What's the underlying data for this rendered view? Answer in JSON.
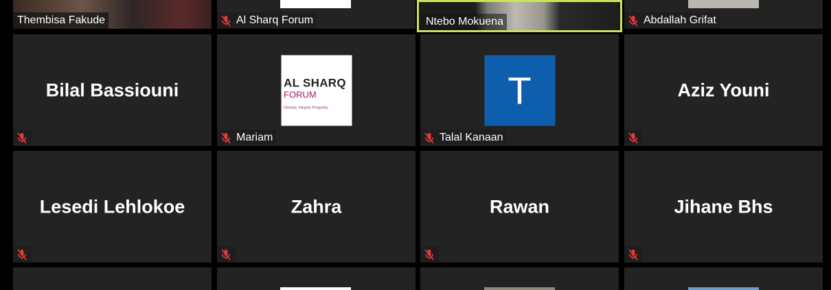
{
  "colors": {
    "tile_bg": "#232323",
    "active_speaker_border": "#c8e45a",
    "mic_muted": "#e03b3b",
    "avatar_bg": "#0e5eae"
  },
  "row1": [
    {
      "name": "Thembisa Fakude",
      "muted": false
    },
    {
      "name": "Al Sharq Forum",
      "muted": true
    },
    {
      "name": "Ntebo Mokuena",
      "muted": false,
      "active": true
    },
    {
      "name": "Abdallah Grifat",
      "muted": true
    }
  ],
  "row2": [
    {
      "big_name": "Bilal Bassiouni",
      "muted": true
    },
    {
      "name": "Mariam",
      "muted": true,
      "logo": {
        "line1": "AL SHARQ",
        "line2": "FORUM",
        "tagline": "Diversity. Integrity. Prosperity."
      }
    },
    {
      "name": "Talal Kanaan",
      "muted": true,
      "avatar_letter": "T"
    },
    {
      "big_name": "Aziz Youni",
      "muted": true
    }
  ],
  "row3": [
    {
      "big_name": "Lesedi Lehlokoe",
      "muted": true
    },
    {
      "big_name": "Zahra",
      "muted": true
    },
    {
      "big_name": "Rawan",
      "muted": true
    },
    {
      "big_name": "Jihane Bhs",
      "muted": true
    }
  ],
  "icons": {
    "mic": "mic-muted-icon"
  }
}
